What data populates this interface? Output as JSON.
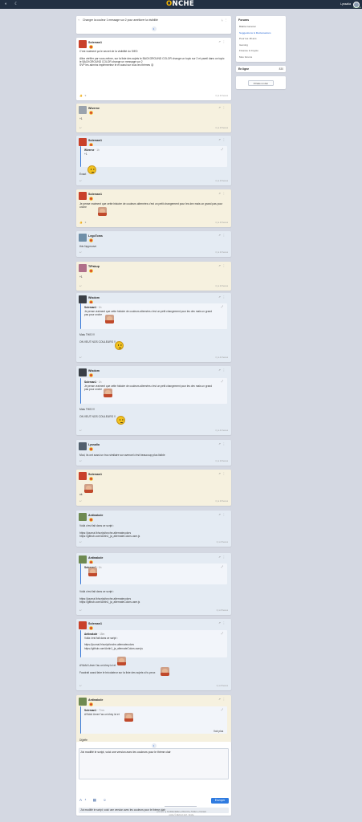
{
  "topbar": {
    "logo_o": "O",
    "logo_rest": "NCHE",
    "user": "Lyssalia",
    "user_status": "Connecté"
  },
  "topic": {
    "title": "Changer la couleur 1 message sur 2 pour améliorer la visibilité",
    "page": "1"
  },
  "posts": [
    {
      "author": "Soleman1",
      "theme": "w",
      "lines": [
        "C'est vraiment ça le secret de la visibilité du SIED",
        "",
        "Allez vérifier par vous-même, sur la liste des sujets le BACKGROUND COLOR change un topic sur 2 et pareil dans un topic le BACKGROUND COLOR change un message sur 2",
        "",
        "SVP les admins implémentez le et aussi sur tous les thèmes 😊"
      ],
      "reactions": "👍 9",
      "date": "il y a 14 heures"
    },
    {
      "author": "Wiverne",
      "theme": "y",
      "lines": [
        "+1"
      ],
      "date": "il y a 13 heures"
    },
    {
      "author": "Soleman1",
      "theme": "b",
      "quote": {
        "author": "Wiverne",
        "when": "· 1h",
        "lines": [
          "+1"
        ]
      },
      "lines": [
        "Exact"
      ],
      "date": "il y a 13 heures"
    },
    {
      "author": "Soleman1",
      "theme": "y",
      "lines": [
        "Je pense vraiment que cette histoire de couleurs alternées c'est un petit changement pour les dev mais un grand pas pour onche"
      ],
      "reactions": "👍 3",
      "date": "il y a 13 heures"
    },
    {
      "author": "LegoToms",
      "theme": "b",
      "lines": [
        "this l'approuve"
      ],
      "date": "il y a 12 heures"
    },
    {
      "author": "TiPakup",
      "theme": "y",
      "lines": [
        "+1"
      ],
      "date": "il y a 12 heures"
    },
    {
      "author": "Wisdom",
      "theme": "b",
      "quote": {
        "author": "Soleman1",
        "when": "· 1h",
        "lines": [
          "Je pense vraiment que cette histoire de couleurs alternées c'est un petit changement pour les dev mais un grand",
          "pas pour onche"
        ]
      },
      "lines": [
        "Mais THIS !!!",
        "",
        "ON VEUT NOS COULEURS !!"
      ],
      "date": "il y a 11 heures"
    },
    {
      "author": "Wisdom",
      "theme": "b",
      "quote": {
        "author": "Soleman1",
        "when": "· 1h",
        "lines": [
          "Je pense vraiment que cette histoire de couleurs alternées c'est un petit changement pour les dev mais un grand",
          "pas pour onche"
        ]
      },
      "lines": [
        "Mais THIS !!!",
        "",
        "ON VEUT NOS COULEURS !!"
      ],
      "date": "il y a 11 heures"
    },
    {
      "author": "Lyssalia",
      "theme": "b",
      "lines": [
        "Mod, ils ont aussi un truc similaire sur avenoel c'est beaucoup plus lisible"
      ],
      "date": "il y a 10 heures"
    },
    {
      "author": "Soleman1",
      "theme": "y",
      "lines": [
        "ok"
      ],
      "date": "il y a 10 heures"
    },
    {
      "author": "Antinakole",
      "theme": "b",
      "lines": [
        "Voilà c'est fait dans ce script :",
        "",
        "https://journal.fr/script/onche-alternatecolors",
        "https://github.com/Antin1_ja_alternateColors.user.js"
      ],
      "date": "il y a 9 heures"
    },
    {
      "author": "Antinakole",
      "theme": "b",
      "quote": {
        "author": "Soleman1",
        "when": "· 1h",
        "lines": [
          ""
        ]
      },
      "lines": [
        "Voilà c'est fait dans ce script :",
        "",
        "https://journal.fr/script/onche-alternatecolors",
        "https://github.com/Antin1_ja_alternateColors.user.js"
      ],
      "date": "il y a 8 heures"
    },
    {
      "author": "Soleman1",
      "theme": "b",
      "quote": {
        "author": "Antinakole",
        "when": "· 15m",
        "lines": [
          "Voilà c'est fait dans ce script :",
          "",
          "https://journal.fr/script/onche-alternatecolors",
          "https://github.com/Antin1_ja_alternateColors.user.js"
        ]
      },
      "lines": [
        "AYAAA Umer l'as un khey ici et",
        "",
        "Faudrait aussi faire le bricolateur sur la liste des sujets si tu peux"
      ],
      "date": "il y a 8 heures"
    },
    {
      "author": "Antinakole",
      "theme": "y",
      "quote": {
        "author": "Soleman1",
        "when": "· 7 hrs",
        "lines": [
          "AYAAA Umer l'as un khey ici et"
        ],
        "more": "Voir plus"
      },
      "lines": [
        "Dijjeffe"
      ],
      "date": "il y a quelques secondes"
    }
  ],
  "reply": {
    "text": "J'ai modifié le script, voici une version avec les couleurs pour le thème clair",
    "send": "Envoyer",
    "preview": "J'ai modifié le script, voici une version avec les couleurs pour le thème clair",
    "page": "1"
  },
  "sidebar": {
    "forums_title": "Forums",
    "forums": [
      "Blabla Général",
      "Suggestions & Réclamations",
      "Pour les 18 ans",
      "Gaming",
      "Finance & Crypto",
      "Mes forums"
    ],
    "active_index": 1,
    "online_label": "En ligne",
    "online_count": "830",
    "fav_button": "Faire un don"
  },
  "footer": {
    "links": "● C.G.U. ● Confidentialité ● Discord ● Twitter ● Contact",
    "copy": "onche © 2024 v2.11.8 · Onche"
  }
}
